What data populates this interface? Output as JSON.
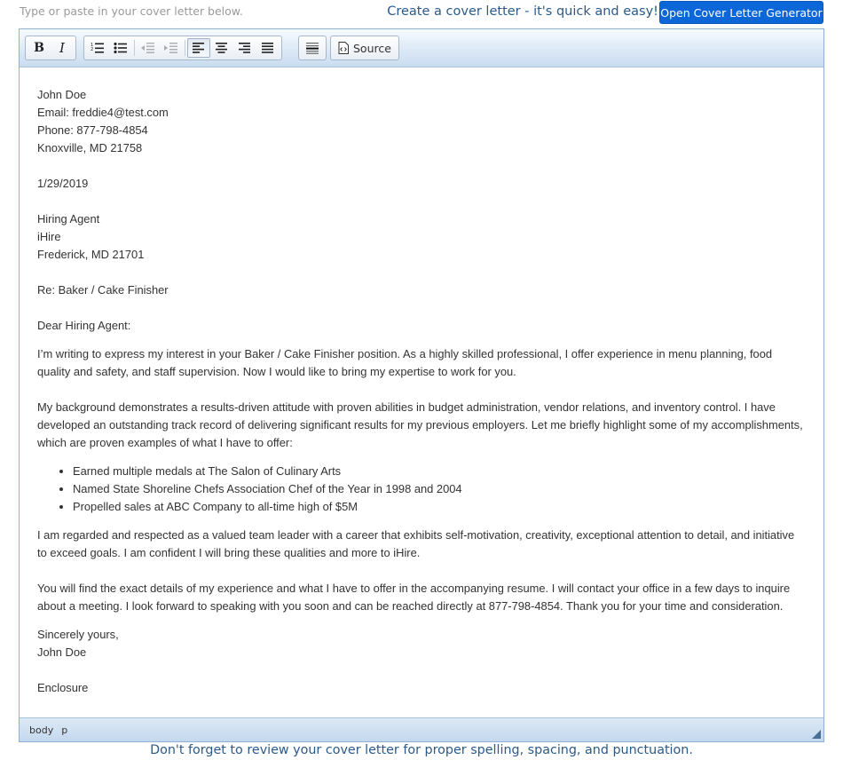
{
  "header": {
    "hint": "Type or paste in your cover letter below.",
    "promo": "Create a cover letter - it's quick and easy!",
    "generator_button": "Open Cover Letter Generator"
  },
  "toolbar": {
    "bold": "B",
    "italic": "I",
    "source": "Source"
  },
  "letter": {
    "name": "John Doe",
    "email": "Email: freddie4@test.com",
    "phone": "Phone: 877-798-4854",
    "address": "Knoxville, MD 21758",
    "date": "1/29/2019",
    "recipient_name": "Hiring Agent",
    "recipient_company": "iHire",
    "recipient_city": "Frederick, MD 21701",
    "subject": "Re: Baker / Cake Finisher",
    "salutation": "Dear Hiring Agent:",
    "para1": "I’m writing to express my interest in your Baker / Cake Finisher position. As a highly skilled professional, I offer experience in menu planning, food quality and safety, and staff supervision. Now I would like to bring my expertise to work for you.",
    "para2": "My background demonstrates a results-driven attitude with proven abilities in budget administration, vendor relations, and inventory control. I have developed an outstanding track record of delivering significant results for my previous employers. Let me briefly highlight some of my accomplishments, which are proven examples of what I have to offer:",
    "bullets": [
      "Earned multiple medals at The Salon of Culinary Arts",
      "Named State Shoreline Chefs Association Chef of the Year in 1998 and 2004",
      "Propelled sales at ABC Company to all-time high of $5M"
    ],
    "para3": "I am regarded and respected as a valued team leader with a career that exhibits self-motivation, creativity, exceptional attention to detail, and initiative to exceed goals. I am confident I will bring these qualities and more to iHire.",
    "para4": "You will find the exact details of my experience and what I have to offer in the accompanying resume. I will contact your office in a few days to inquire about a meeting. I look forward to speaking with you soon and can be reached directly at 877-798-4854. Thank you for your time and consideration.",
    "closing": "Sincerely yours,",
    "signature": "John Doe",
    "enclosure": "Enclosure"
  },
  "statusbar": {
    "path": [
      "body",
      "p"
    ]
  },
  "footer": {
    "note": "Don't forget to review your cover letter for proper spelling, spacing, and punctuation."
  },
  "colors": {
    "accent_button": "#0b67d8",
    "promo_text": "#2b5a8a",
    "editor_border": "#8fb3d6"
  }
}
